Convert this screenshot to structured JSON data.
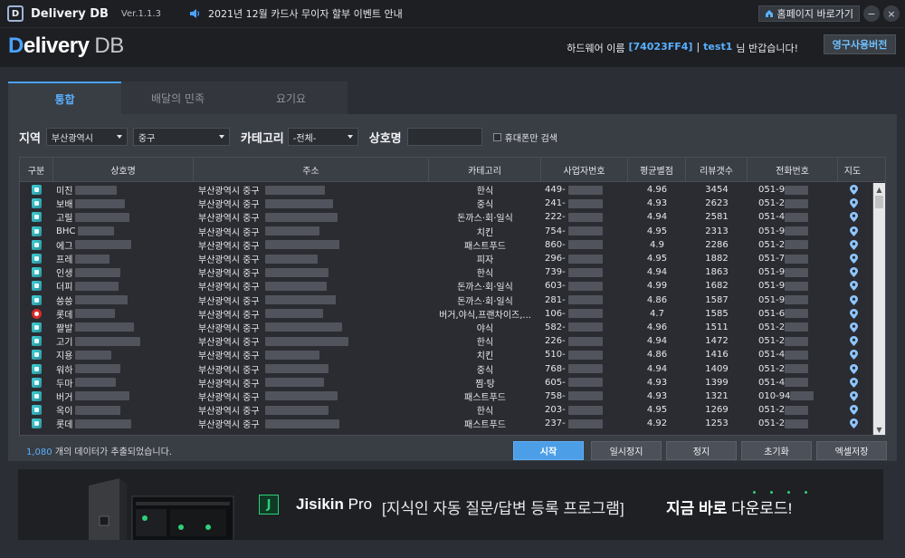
{
  "titlebar": {
    "logo_letter": "D",
    "app_name": "Delivery DB",
    "version": "Ver.1.1.3",
    "notice": "2021년 12월 카드사 무이자 할부 이벤트 안내",
    "home_label": "홈페이지 바로가기",
    "min_label": "−",
    "close_label": "×"
  },
  "header": {
    "brand_first": "D",
    "brand_rest": "elivery",
    "brand_db": "DB",
    "hw_prefix": "하드웨어 이름",
    "hw_id": "[74023FF4]",
    "sep": "|",
    "user_id": "test1",
    "greet_suffix": "님 반갑습니다!",
    "license_label": "영구사용버전"
  },
  "tabs": [
    {
      "label": "통합"
    },
    {
      "label": "배달의 민족"
    },
    {
      "label": "요기요"
    }
  ],
  "filter": {
    "region_label": "지역",
    "region_value": "부산광역시",
    "district_value": "중구",
    "category_label": "카테고리",
    "category_value": "-전체-",
    "store_label": "상호명",
    "store_value": "",
    "closed_only_label": "휴대폰만 검색"
  },
  "table": {
    "columns": [
      "구분",
      "상호명",
      "주소",
      "카테고리",
      "사업자번호",
      "평균별점",
      "리뷰갯수",
      "전화번호",
      "지도"
    ],
    "rows": [
      {
        "name": "미진",
        "addr": "부산광역시 중구",
        "cat": "한식",
        "biz": "449-",
        "rate": "4.96",
        "reviews": "3454",
        "phone": "051-9"
      },
      {
        "name": "보배",
        "addr": "부산광역시 중구",
        "cat": "중식",
        "biz": "241-",
        "rate": "4.93",
        "reviews": "2623",
        "phone": "051-2"
      },
      {
        "name": "고릴",
        "addr": "부산광역시 중구",
        "cat": "돈까스·회·일식",
        "biz": "222-",
        "rate": "4.94",
        "reviews": "2581",
        "phone": "051-4"
      },
      {
        "name": "BHC",
        "addr": "부산광역시 중구",
        "cat": "치킨",
        "biz": "754-",
        "rate": "4.95",
        "reviews": "2313",
        "phone": "051-9"
      },
      {
        "name": "에그",
        "addr": "부산광역시 중구",
        "cat": "패스트푸드",
        "biz": "860-",
        "rate": "4.9",
        "reviews": "2286",
        "phone": "051-2"
      },
      {
        "name": "프레",
        "addr": "부산광역시 중구",
        "cat": "피자",
        "biz": "296-",
        "rate": "4.95",
        "reviews": "1882",
        "phone": "051-7"
      },
      {
        "name": "인생",
        "addr": "부산광역시 중구",
        "cat": "한식",
        "biz": "739-",
        "rate": "4.94",
        "reviews": "1863",
        "phone": "051-9"
      },
      {
        "name": "더피",
        "addr": "부산광역시 중구",
        "cat": "돈까스·회·일식",
        "biz": "603-",
        "rate": "4.99",
        "reviews": "1682",
        "phone": "051-9"
      },
      {
        "name": "씅씅",
        "addr": "부산광역시 중구",
        "cat": "돈까스·회·일식",
        "biz": "281-",
        "rate": "4.86",
        "reviews": "1587",
        "phone": "051-9"
      },
      {
        "name": "롯데",
        "addr": "부산광역시 중구",
        "cat": "버거,야식,프랜차이즈,...",
        "biz": "106-",
        "rate": "4.7",
        "reviews": "1585",
        "phone": "051-6",
        "alt": true
      },
      {
        "name": "짤발",
        "addr": "부산광역시 중구",
        "cat": "야식",
        "biz": "582-",
        "rate": "4.96",
        "reviews": "1511",
        "phone": "051-2"
      },
      {
        "name": "고기",
        "addr": "부산광역시 중구",
        "cat": "한식",
        "biz": "226-",
        "rate": "4.94",
        "reviews": "1472",
        "phone": "051-2"
      },
      {
        "name": "지용",
        "addr": "부산광역시 중구",
        "cat": "치킨",
        "biz": "510-",
        "rate": "4.86",
        "reviews": "1416",
        "phone": "051-4"
      },
      {
        "name": "워하",
        "addr": "부산광역시 중구",
        "cat": "중식",
        "biz": "768-",
        "rate": "4.94",
        "reviews": "1409",
        "phone": "051-2"
      },
      {
        "name": "두마",
        "addr": "부산광역시 중구",
        "cat": "찜·탕",
        "biz": "605-",
        "rate": "4.93",
        "reviews": "1399",
        "phone": "051-4"
      },
      {
        "name": "버거",
        "addr": "부산광역시 중구",
        "cat": "패스트푸드",
        "biz": "758-",
        "rate": "4.93",
        "reviews": "1321",
        "phone": "010-94"
      },
      {
        "name": "옥이",
        "addr": "부산광역시 중구",
        "cat": "한식",
        "biz": "203-",
        "rate": "4.95",
        "reviews": "1269",
        "phone": "051-2"
      },
      {
        "name": "롯데",
        "addr": "부산광역시 중구",
        "cat": "패스트푸드",
        "biz": "237-",
        "rate": "4.92",
        "reviews": "1253",
        "phone": "051-2"
      }
    ]
  },
  "status": {
    "count": "1,080",
    "count_suffix": "개의 데이터가 추출되었습니다."
  },
  "actions": {
    "start": "시작",
    "pause": "일시정지",
    "stop": "정지",
    "reset": "초기화",
    "excel": "엑셀저장"
  },
  "banner": {
    "logo_letter": "J",
    "product_first": "Jisikin",
    "product_second": "Pro",
    "desc": "[지식인 자동 질문/답변 등록 프로그램]",
    "cta_bold": "지금 바로",
    "cta_rest": "다운로드!"
  },
  "colors": {
    "accent": "#4aa3ff",
    "primary_button": "#4c9ee6",
    "banner_green": "#2fd07a"
  }
}
